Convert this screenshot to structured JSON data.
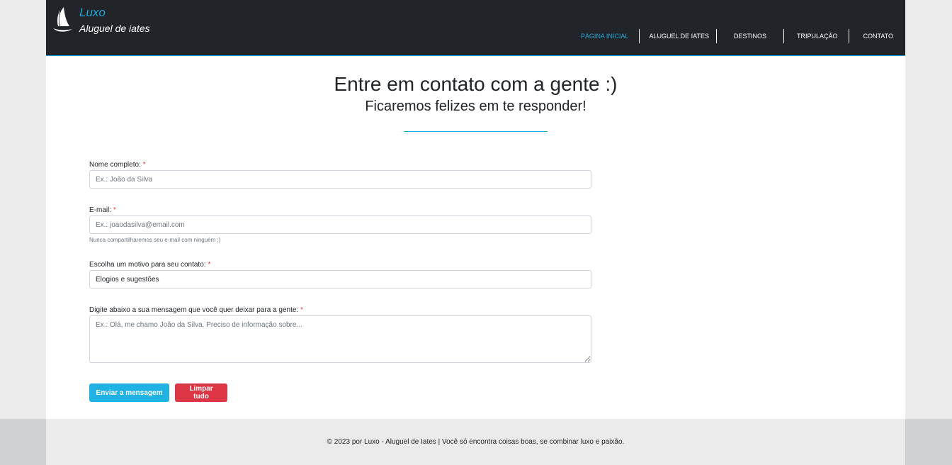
{
  "nav": {
    "brand_name": "Luxo",
    "brand_sub": "Aluguel de iates",
    "items": [
      {
        "label": "PÁGINA INICIAL",
        "active": true
      },
      {
        "label": "ALUGUEL DE IATES",
        "active": false
      },
      {
        "label": "DESTINOS",
        "active": false
      },
      {
        "label": "TRIPULAÇÃO",
        "active": false
      },
      {
        "label": "CONTATO",
        "active": false
      }
    ]
  },
  "header": {
    "title": "Entre em contato com a gente :)",
    "subtitle": "Ficaremos felizes em te responder!"
  },
  "form": {
    "name": {
      "label": "Nome completo:",
      "required": "*",
      "placeholder": "Ex.: João da Silva",
      "value": ""
    },
    "email": {
      "label": "E-mail:",
      "required": "*",
      "placeholder": "Ex.: joaodasilva@email.com",
      "value": "",
      "help": "Nunca compartilharemos seu e-mail com ninguém ;)"
    },
    "reason": {
      "label": "Escolha um motivo para seu contato:",
      "required": "*",
      "selected": "Elogios e sugestões"
    },
    "message": {
      "label": "Digite abaixo a sua mensagem que você quer deixar para a gente:",
      "required": "*",
      "placeholder": "Ex.: Olá, me chamo João da Silva. Preciso de informação sobre...",
      "value": ""
    }
  },
  "buttons": {
    "send": "Enviar a mensagem",
    "clear": "Limpar tudo"
  },
  "footer": {
    "text": "© 2023 por Luxo - Aluguel de Iates | Você só encontra coisas boas, se combinar luxo e paixão."
  },
  "colors": {
    "accent": "#1fa5d8",
    "navbar": "#212529",
    "danger": "#dc3545",
    "send_button": "#1fb2e2"
  }
}
